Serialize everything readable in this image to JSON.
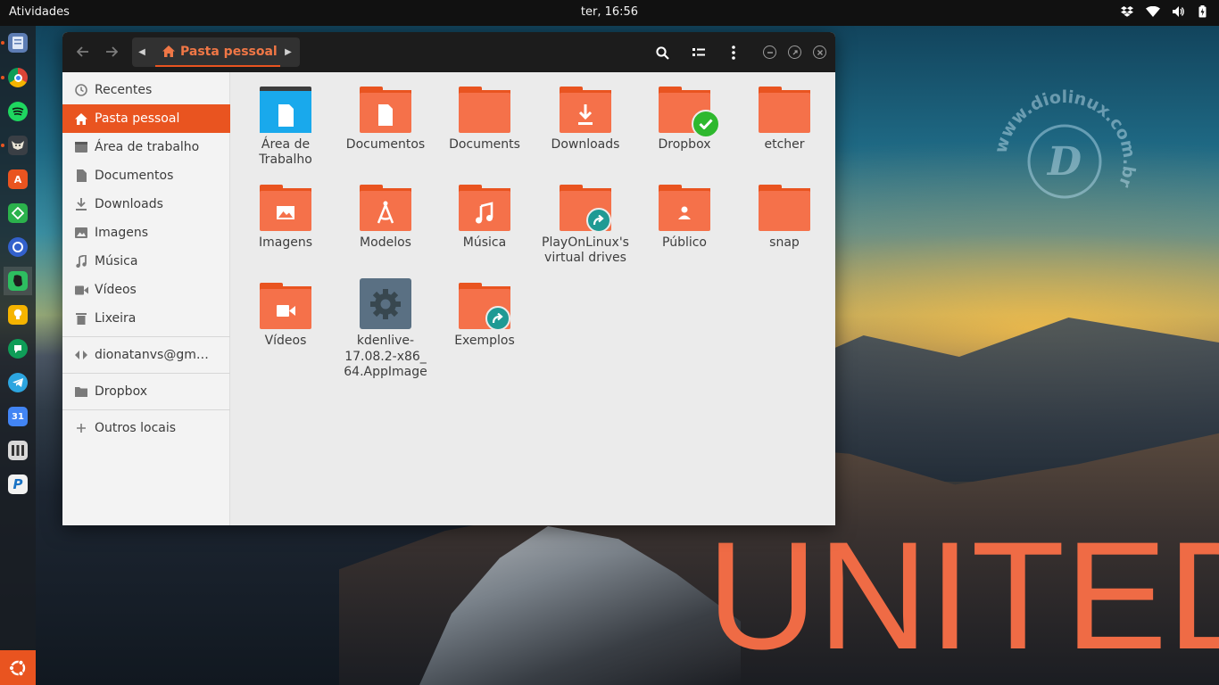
{
  "topbar": {
    "activities": "Atividades",
    "clock": "ter, 16:56"
  },
  "window": {
    "path": "Pasta pessoal",
    "sidebar": [
      {
        "label": "Recentes",
        "icon": "clock-icon"
      },
      {
        "label": "Pasta pessoal",
        "icon": "home-icon",
        "selected": true
      },
      {
        "label": "Área de trabalho",
        "icon": "desktop-icon"
      },
      {
        "label": "Documentos",
        "icon": "document-icon"
      },
      {
        "label": "Downloads",
        "icon": "download-icon"
      },
      {
        "label": "Imagens",
        "icon": "image-icon"
      },
      {
        "label": "Música",
        "icon": "music-icon"
      },
      {
        "label": "Vídeos",
        "icon": "video-icon"
      },
      {
        "label": "Lixeira",
        "icon": "trash-icon"
      }
    ],
    "sidebar_account": "dionatanvs@gm…",
    "sidebar_dropbox": "Dropbox",
    "sidebar_other": "Outros locais",
    "files": [
      {
        "name": "Área de\nTrabalho",
        "icon": "desktop-folder-icon"
      },
      {
        "name": "Documentos",
        "icon": "documents-folder-icon"
      },
      {
        "name": "Documents",
        "icon": "folder-icon"
      },
      {
        "name": "Downloads",
        "icon": "downloads-folder-icon"
      },
      {
        "name": "Dropbox",
        "icon": "dropbox-folder-icon"
      },
      {
        "name": "etcher",
        "icon": "folder-icon"
      },
      {
        "name": "Imagens",
        "icon": "pictures-folder-icon"
      },
      {
        "name": "Modelos",
        "icon": "templates-folder-icon"
      },
      {
        "name": "Música",
        "icon": "music-folder-icon"
      },
      {
        "name": "PlayOnLinux's\nvirtual drives",
        "icon": "symlink-folder-icon"
      },
      {
        "name": "Público",
        "icon": "public-folder-icon"
      },
      {
        "name": "snap",
        "icon": "folder-icon"
      },
      {
        "name": "Vídeos",
        "icon": "videos-folder-icon"
      },
      {
        "name": "kdenlive-\n17.08.2-x86_\n64.AppImage",
        "icon": "executable-gear-icon"
      },
      {
        "name": "Exemplos",
        "icon": "symlink-folder-icon"
      }
    ]
  },
  "wallpaper": {
    "title": "UNITED",
    "watermark": "www.diolinux.com.br",
    "accent": "#e95420"
  }
}
